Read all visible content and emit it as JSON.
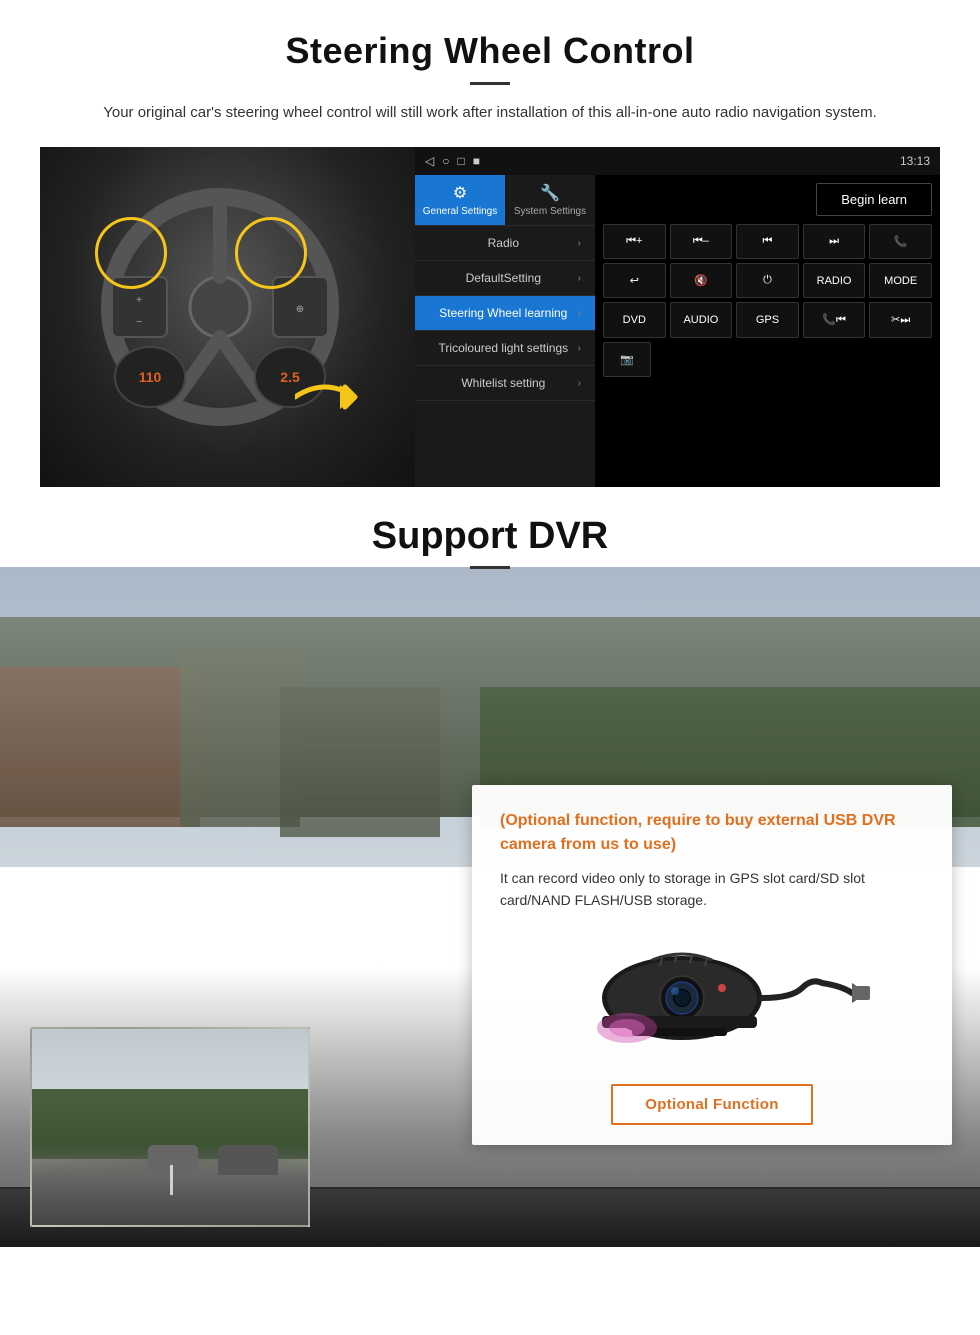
{
  "steering": {
    "title": "Steering Wheel Control",
    "description": "Your original car's steering wheel control will still work after installation of this all-in-one auto radio navigation system.",
    "statusbar": {
      "time": "13:13",
      "icons": [
        "◁",
        "○",
        "□",
        "■"
      ]
    },
    "tabs": [
      {
        "label": "General Settings",
        "active": true
      },
      {
        "label": "System Settings",
        "active": false
      }
    ],
    "menu_items": [
      {
        "label": "Radio",
        "active": false
      },
      {
        "label": "DefaultSetting",
        "active": false
      },
      {
        "label": "Steering Wheel learning",
        "active": true
      },
      {
        "label": "Tricoloured light settings",
        "active": false
      },
      {
        "label": "Whitelist setting",
        "active": false
      }
    ],
    "begin_learn": "Begin learn",
    "control_buttons": {
      "row1": [
        "⏮+",
        "⏮-",
        "⏮",
        "⏭",
        "📞"
      ],
      "row2": [
        "↩",
        "🔇",
        "⏻",
        "RADIO",
        "MODE"
      ],
      "row3": [
        "DVD",
        "AUDIO",
        "GPS",
        "📞⏮",
        "✂⏭"
      ],
      "row4": [
        "📷"
      ]
    }
  },
  "dvr": {
    "title": "Support DVR",
    "card": {
      "title": "(Optional function, require to buy external USB DVR camera from us to use)",
      "body": "It can record video only to storage in GPS slot card/SD slot card/NAND FLASH/USB storage."
    },
    "optional_button": "Optional Function"
  }
}
